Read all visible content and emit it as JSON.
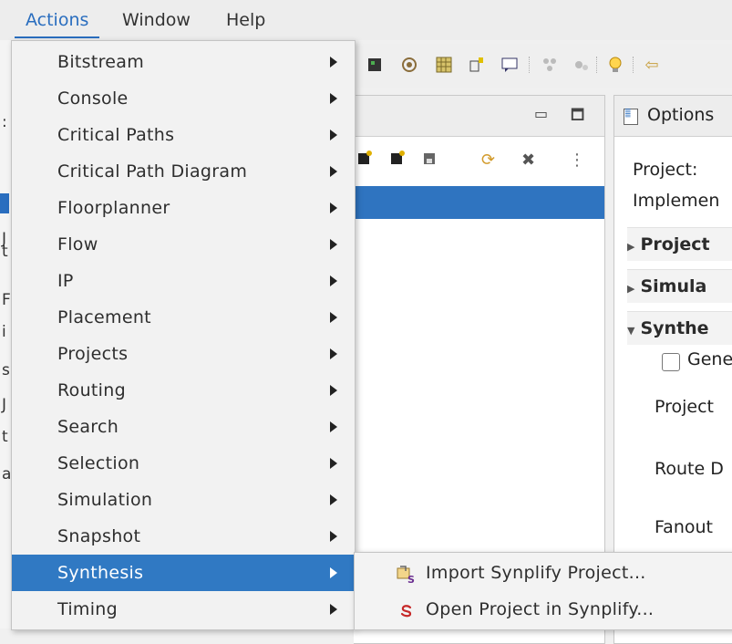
{
  "menubar": {
    "items": [
      {
        "label": "Actions",
        "active": true
      },
      {
        "label": "Window",
        "active": false
      },
      {
        "label": "Help",
        "active": false
      }
    ]
  },
  "actions_menu": {
    "items": [
      {
        "label": "Bitstream",
        "has_submenu": true
      },
      {
        "label": "Console",
        "has_submenu": true
      },
      {
        "label": "Critical Paths",
        "has_submenu": true
      },
      {
        "label": "Critical Path Diagram",
        "has_submenu": true
      },
      {
        "label": "Floorplanner",
        "has_submenu": true
      },
      {
        "label": "Flow",
        "has_submenu": true
      },
      {
        "label": "IP",
        "has_submenu": true
      },
      {
        "label": "Placement",
        "has_submenu": true
      },
      {
        "label": "Projects",
        "has_submenu": true
      },
      {
        "label": "Routing",
        "has_submenu": true
      },
      {
        "label": "Search",
        "has_submenu": true
      },
      {
        "label": "Selection",
        "has_submenu": true
      },
      {
        "label": "Simulation",
        "has_submenu": true
      },
      {
        "label": "Snapshot",
        "has_submenu": true
      },
      {
        "label": "Synthesis",
        "has_submenu": true,
        "highlighted": true
      },
      {
        "label": "Timing",
        "has_submenu": true
      }
    ]
  },
  "synthesis_submenu": {
    "items": [
      {
        "label": "Import Synplify Project...",
        "icon": "synplify-import-icon"
      },
      {
        "label": "Open Project in Synplify...",
        "icon": "synplify-open-icon"
      }
    ]
  },
  "options_panel": {
    "title": "Options",
    "project_label": "Project:",
    "implementation_label": "Implemen",
    "sections": [
      "Project",
      "Simula",
      "Synthe"
    ],
    "checkbox_label": "Gene",
    "fields": [
      "Project",
      "Route D",
      "Fanout"
    ]
  },
  "left_strip_chars": [
    ":",
    "S",
    "J",
    "t",
    "F",
    "i",
    "s",
    "J",
    "t",
    "a"
  ],
  "colors": {
    "accent": "#2a6ebf",
    "highlight": "#3079c3",
    "selected_row": "#2f74c0"
  }
}
